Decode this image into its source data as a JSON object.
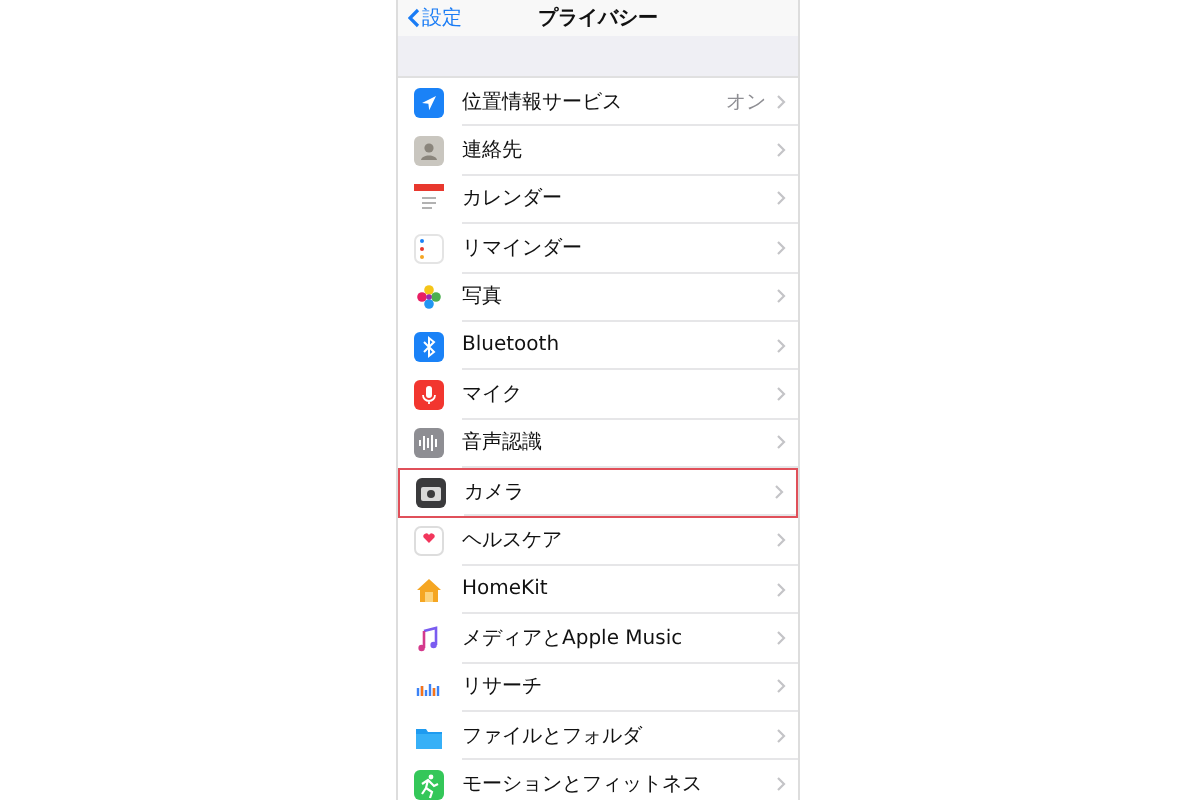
{
  "nav": {
    "back": "設定",
    "title": "プライバシー"
  },
  "items": [
    {
      "label": "位置情報サービス",
      "value": "オン",
      "highlighted": false
    },
    {
      "label": "連絡先",
      "highlighted": false
    },
    {
      "label": "カレンダー",
      "highlighted": false
    },
    {
      "label": "リマインダー",
      "highlighted": false
    },
    {
      "label": "写真",
      "highlighted": false
    },
    {
      "label": "Bluetooth",
      "highlighted": false
    },
    {
      "label": "マイク",
      "highlighted": false
    },
    {
      "label": "音声認識",
      "highlighted": false
    },
    {
      "label": "カメラ",
      "highlighted": true
    },
    {
      "label": "ヘルスケア",
      "highlighted": false
    },
    {
      "label": "HomeKit",
      "highlighted": false
    },
    {
      "label": "メディアとApple Music",
      "highlighted": false
    },
    {
      "label": "リサーチ",
      "highlighted": false
    },
    {
      "label": "ファイルとフォルダ",
      "highlighted": false
    },
    {
      "label": "モーションとフィットネス",
      "highlighted": false
    }
  ]
}
